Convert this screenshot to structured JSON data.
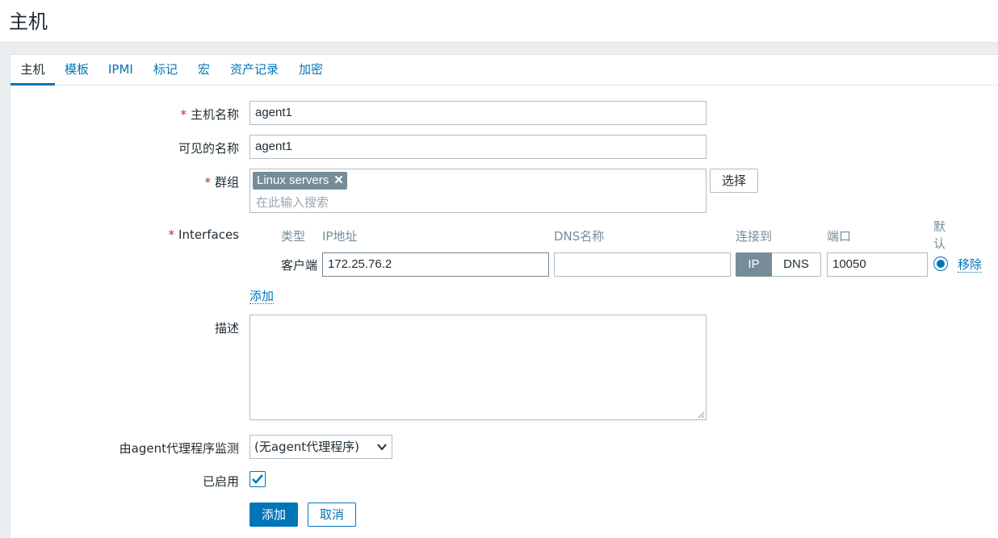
{
  "page": {
    "title": "主机"
  },
  "tabs": [
    {
      "label": "主机"
    },
    {
      "label": "模板"
    },
    {
      "label": "IPMI"
    },
    {
      "label": "标记"
    },
    {
      "label": "宏"
    },
    {
      "label": "资产记录"
    },
    {
      "label": "加密"
    }
  ],
  "form": {
    "host_name": {
      "label": "主机名称",
      "required": true,
      "value": "agent1"
    },
    "visible_name": {
      "label": "可见的名称",
      "value": "agent1"
    },
    "groups": {
      "label": "群组",
      "required": true,
      "chips": [
        "Linux servers"
      ],
      "placeholder": "在此输入搜索",
      "select_button": "选择"
    },
    "interfaces": {
      "label": "Interfaces",
      "required": true,
      "columns": {
        "type": "类型",
        "ip": "IP地址",
        "dns": "DNS名称",
        "connect_to": "连接到",
        "port": "端口",
        "default": "默认"
      },
      "rows": [
        {
          "type": "客户端",
          "ip": "172.25.76.2",
          "dns": "",
          "connect_options": [
            "IP",
            "DNS"
          ],
          "connect_selected": "IP",
          "port": "10050",
          "default": true,
          "remove_label": "移除"
        }
      ],
      "add_label": "添加"
    },
    "description": {
      "label": "描述",
      "value": ""
    },
    "proxy": {
      "label": "由agent代理程序监测",
      "selected": "(无agent代理程序)"
    },
    "enabled": {
      "label": "已启用",
      "checked": true
    },
    "buttons": {
      "add": "添加",
      "cancel": "取消"
    }
  },
  "colors": {
    "accent": "#0275b8",
    "required": "#d81e06",
    "chip": "#768d99"
  }
}
